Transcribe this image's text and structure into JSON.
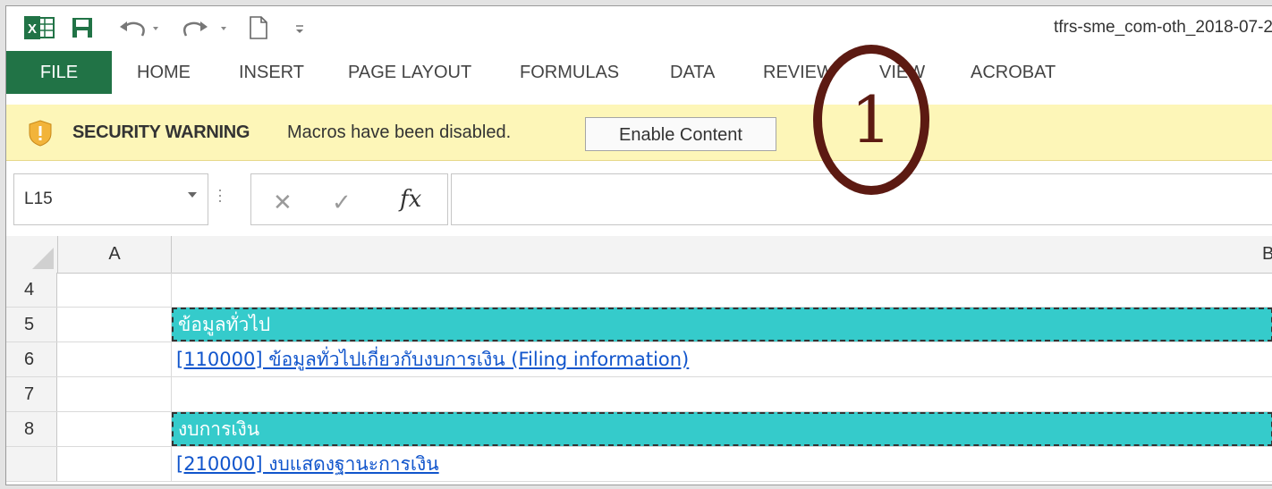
{
  "quick_access": {
    "app_icon": "excel-logo-icon",
    "icons": [
      "save-icon",
      "undo-icon",
      "redo-icon",
      "new-document-icon",
      "customize-toolbar-icon"
    ]
  },
  "window": {
    "title": "tfrs-sme_com-oth_2018-07-2"
  },
  "ribbon": {
    "tabs": [
      {
        "label": "FILE"
      },
      {
        "label": "HOME"
      },
      {
        "label": "INSERT"
      },
      {
        "label": "PAGE LAYOUT"
      },
      {
        "label": "FORMULAS"
      },
      {
        "label": "DATA"
      },
      {
        "label": "REVIEW"
      },
      {
        "label": "VIEW"
      },
      {
        "label": "ACROBAT"
      }
    ]
  },
  "security_bar": {
    "title": "SECURITY WARNING",
    "message": "Macros have been disabled.",
    "button_label": "Enable Content"
  },
  "formula_bar": {
    "name_box": "L15",
    "fx_label": "fx"
  },
  "grid": {
    "columns": [
      "A",
      "B"
    ],
    "rows": [
      {
        "num": "4",
        "b": ""
      },
      {
        "num": "5",
        "b": "ข้อมูลทั่วไป"
      },
      {
        "num": "6",
        "b": "[110000] ข้อมูลทั่วไปเกี่ยวกับงบการเงิน (Filing information)"
      },
      {
        "num": "7",
        "b": ""
      },
      {
        "num": "8",
        "b": "งบการเงิน"
      },
      {
        "num": "",
        "b": "[210000] งบแสดงฐานะการเงิน"
      }
    ]
  },
  "annotation": {
    "label": "1"
  },
  "colors": {
    "file_tab": "#217346",
    "security_bg": "#fdf6b8",
    "section_band": "#35cbcb",
    "link": "#1155cc",
    "annotation": "#5c1a12"
  }
}
